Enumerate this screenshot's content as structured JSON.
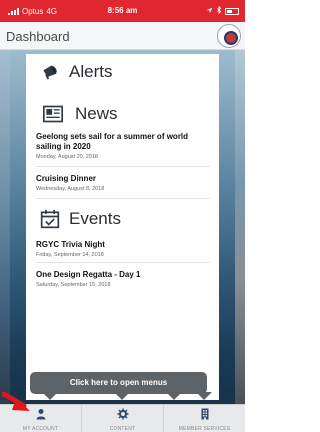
{
  "status_bar": {
    "carrier": "Optus",
    "network": "4G",
    "time": "8:56 am"
  },
  "header": {
    "title": "Dashboard"
  },
  "sections": {
    "alerts": {
      "label": "Alerts",
      "icon": "megaphone-icon"
    },
    "news": {
      "label": "News",
      "icon": "newspaper-icon",
      "items": [
        {
          "title": "Geelong sets sail for a summer of world sailing in 2020",
          "date": "Monday, August 20, 2018"
        },
        {
          "title": "Cruising Dinner",
          "date": "Wednesday, August 8, 2018"
        }
      ]
    },
    "events": {
      "label": "Events",
      "icon": "calendar-check-icon",
      "items": [
        {
          "title": "RGYC Trivia Night",
          "date": "Friday, September 14, 2018"
        },
        {
          "title": "One Design Regatta - Day 1",
          "date": "Saturday, September 15, 2018"
        }
      ]
    }
  },
  "tooltip": {
    "text": "Click here to open menus"
  },
  "tabbar": {
    "tabs": [
      {
        "label": "MY ACCOUNT",
        "icon": "person-icon"
      },
      {
        "label": "CONTENT",
        "icon": "gear-icon"
      },
      {
        "label": "MEMBER SERVICES",
        "icon": "building-icon"
      }
    ]
  },
  "colors": {
    "status_bar": "#e0262f",
    "tooltip": "#5e6367",
    "annotation_arrow": "#e0161d"
  }
}
